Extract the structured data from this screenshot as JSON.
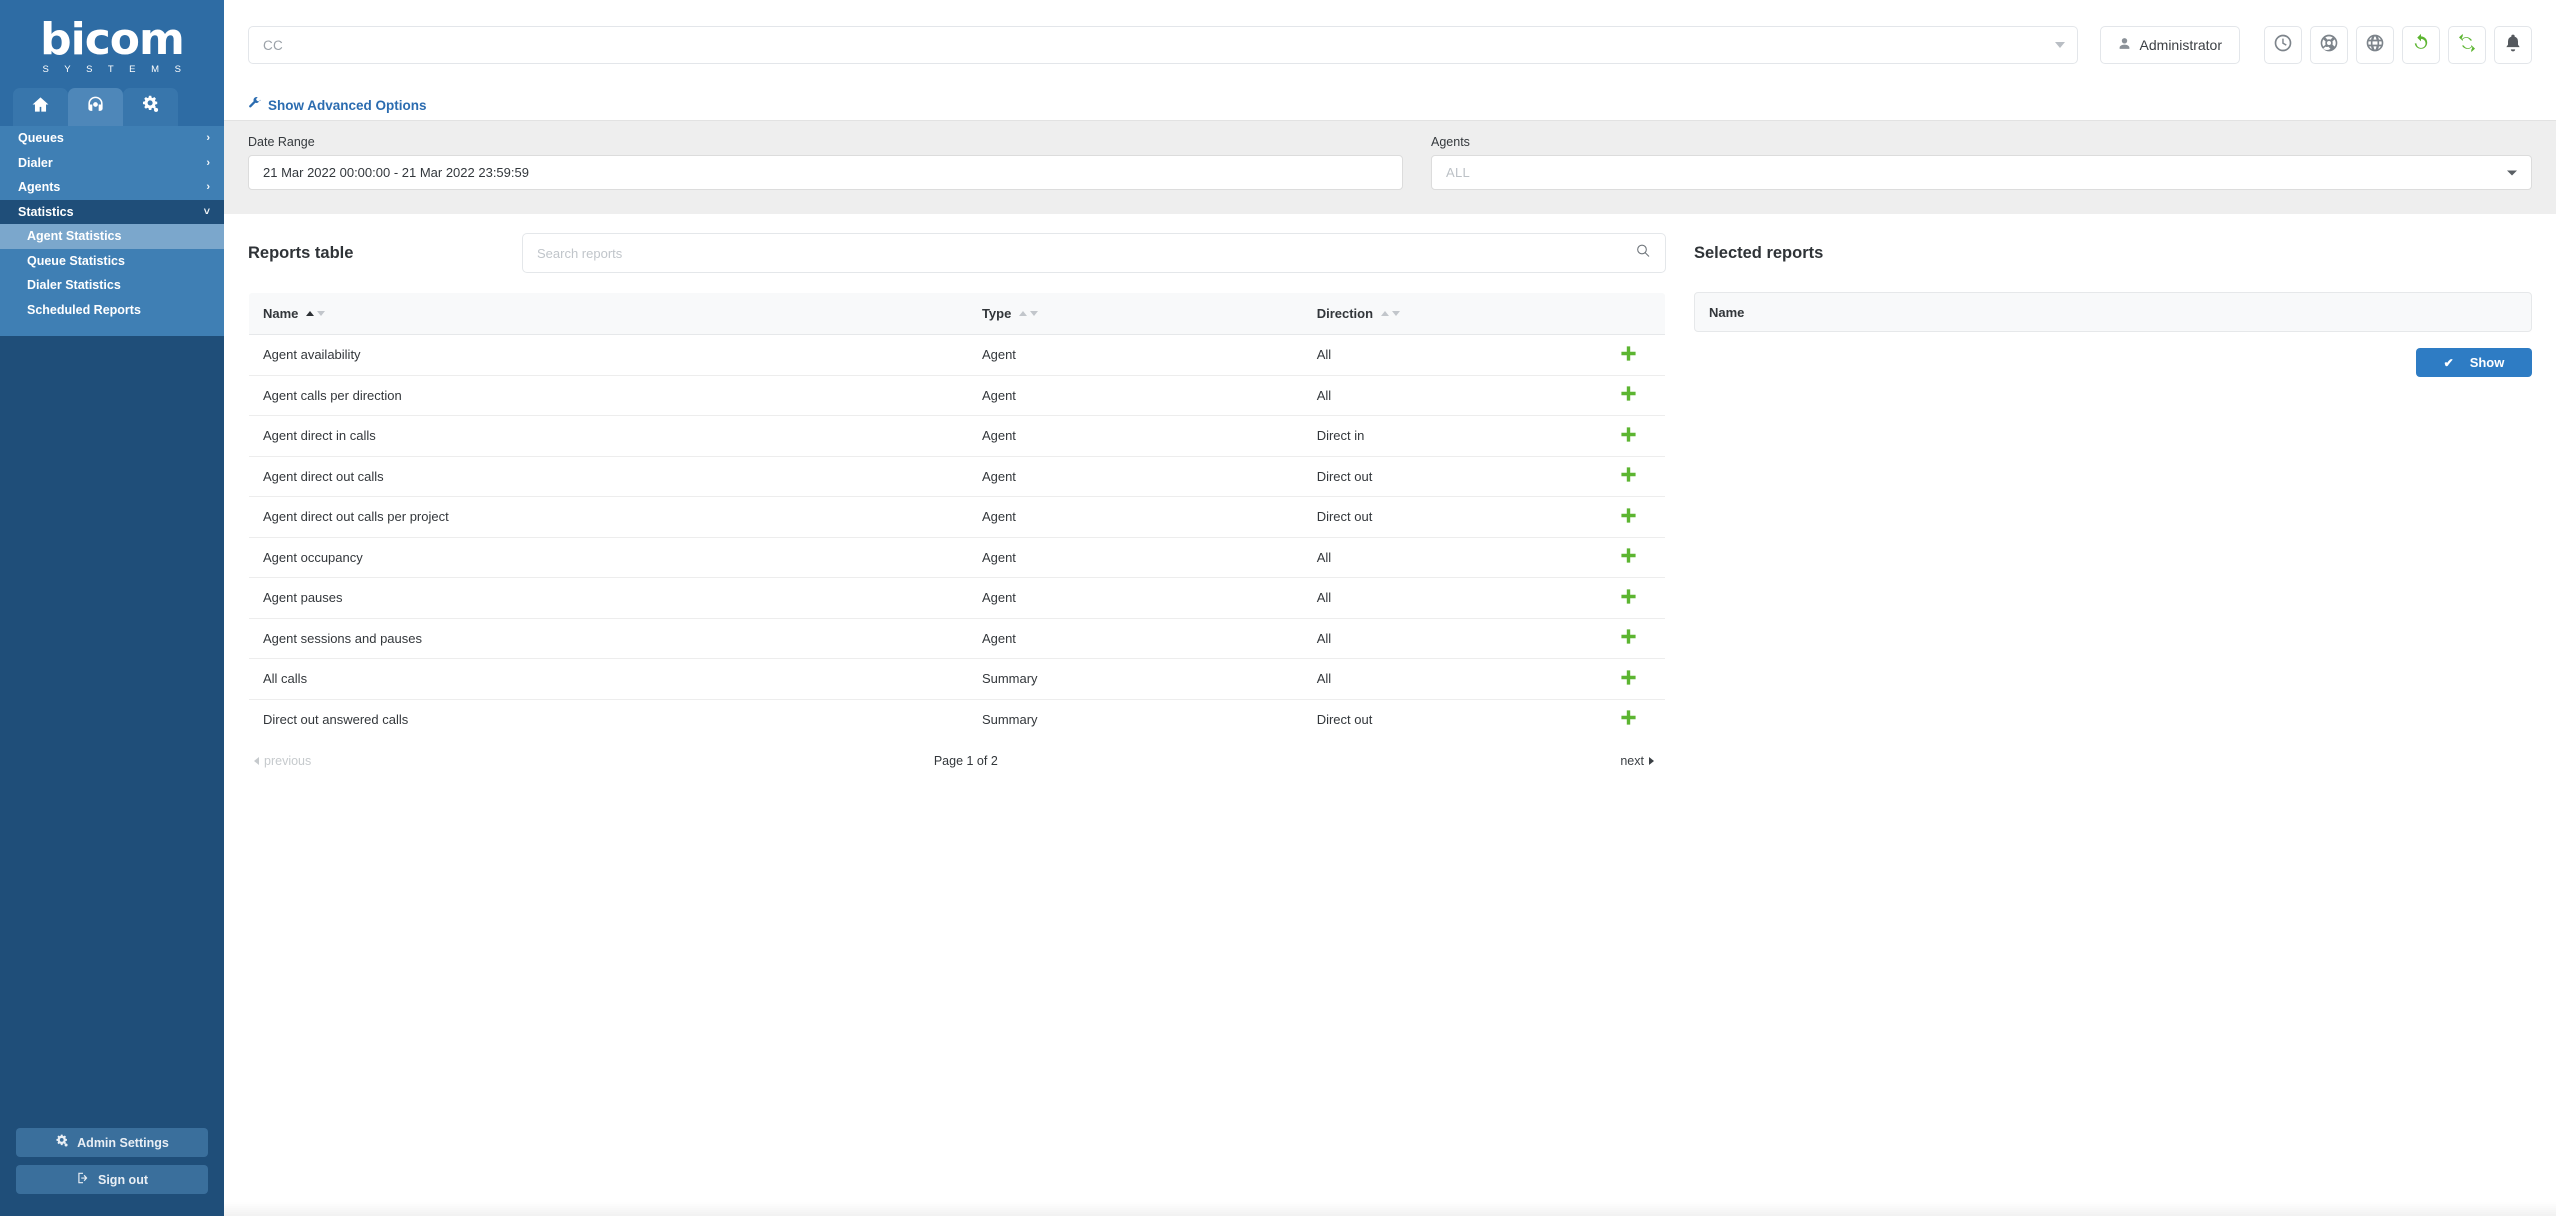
{
  "brand": {
    "name": "bicom",
    "tagline": "S Y S T E M S"
  },
  "sidebar": {
    "tabs": [
      {
        "name": "home-tab",
        "icon": "home-icon"
      },
      {
        "name": "contact-center-tab",
        "icon": "headset-icon"
      },
      {
        "name": "settings-tab",
        "icon": "gears-icon"
      }
    ],
    "menu": [
      {
        "label": "Queues",
        "chevron": "›",
        "open": false
      },
      {
        "label": "Dialer",
        "chevron": "›",
        "open": false
      },
      {
        "label": "Agents",
        "chevron": "›",
        "open": false
      },
      {
        "label": "Statistics",
        "chevron": "˅",
        "open": true
      }
    ],
    "submenu": [
      {
        "label": "Agent Statistics",
        "selected": true
      },
      {
        "label": "Queue Statistics",
        "selected": false
      },
      {
        "label": "Dialer Statistics",
        "selected": false
      },
      {
        "label": "Scheduled Reports",
        "selected": false
      }
    ],
    "admin_settings_label": "Admin Settings",
    "sign_out_label": "Sign out"
  },
  "topbar": {
    "tenant_value": "CC",
    "tenant_placeholder": "CC",
    "user_label": "Administrator",
    "icons": [
      {
        "name": "clock-icon"
      },
      {
        "name": "lifebuoy-icon"
      },
      {
        "name": "globe-icon"
      },
      {
        "name": "reload-icon"
      },
      {
        "name": "sync-icon"
      },
      {
        "name": "bell-icon"
      }
    ],
    "advanced_options_label": "Show Advanced Options"
  },
  "filters": {
    "date_range_label": "Date Range",
    "date_range_value": "21 Mar 2022 00:00:00 - 21 Mar 2022 23:59:59",
    "agents_label": "Agents",
    "agents_placeholder": "ALL"
  },
  "reports_panel": {
    "title": "Reports table",
    "search_placeholder": "Search reports",
    "columns": [
      {
        "label": "Name",
        "sort_asc_active": true,
        "sort_desc_active": false
      },
      {
        "label": "Type",
        "sort_asc_active": false,
        "sort_desc_active": false
      },
      {
        "label": "Direction",
        "sort_asc_active": false,
        "sort_desc_active": false
      }
    ],
    "rows": [
      {
        "name": "Agent availability",
        "type": "Agent",
        "direction": "All"
      },
      {
        "name": "Agent calls per direction",
        "type": "Agent",
        "direction": "All"
      },
      {
        "name": "Agent direct in calls",
        "type": "Agent",
        "direction": "Direct in"
      },
      {
        "name": "Agent direct out calls",
        "type": "Agent",
        "direction": "Direct out"
      },
      {
        "name": "Agent direct out calls per project",
        "type": "Agent",
        "direction": "Direct out"
      },
      {
        "name": "Agent occupancy",
        "type": "Agent",
        "direction": "All"
      },
      {
        "name": "Agent pauses",
        "type": "Agent",
        "direction": "All"
      },
      {
        "name": "Agent sessions and pauses",
        "type": "Agent",
        "direction": "All"
      },
      {
        "name": "All calls",
        "type": "Summary",
        "direction": "All"
      },
      {
        "name": "Direct out answered calls",
        "type": "Summary",
        "direction": "Direct out"
      }
    ],
    "pager": {
      "previous": "previous",
      "page_info": "Page 1 of 2",
      "next": "next"
    }
  },
  "selected_panel": {
    "title": "Selected reports",
    "column_name": "Name",
    "show_label": "Show",
    "show_check": "✔"
  },
  "colors": {
    "sidebar": "#2e6ca4",
    "sidebar_menu": "#3f7fb4",
    "sidebar_open": "#1f4e79",
    "sidebar_selected": "#7ba7cc",
    "accent_blue": "#2e7cc4",
    "link_blue": "#2b6cb0",
    "green": "#5cb531",
    "band_gray": "#eeeeee"
  }
}
